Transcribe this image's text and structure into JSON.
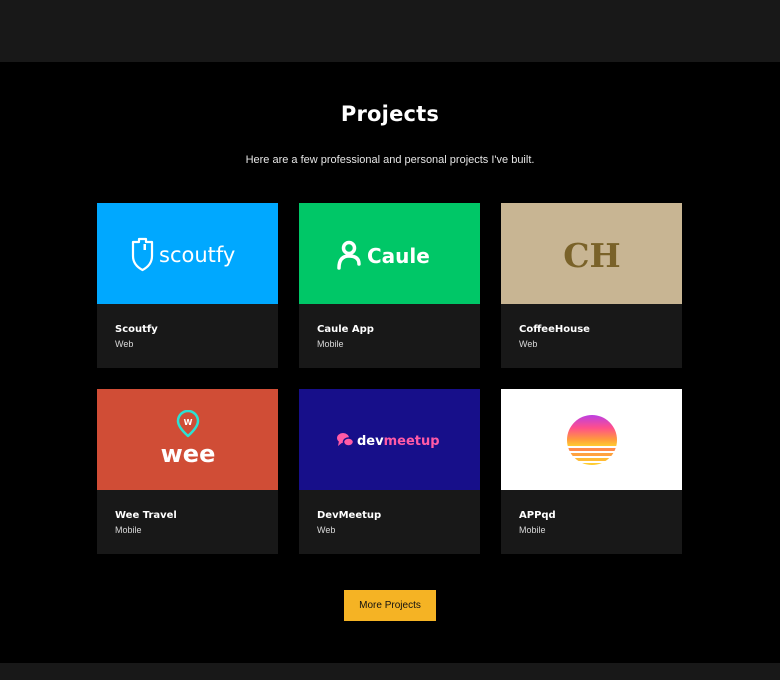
{
  "section": {
    "title": "Projects",
    "subtitle": "Here are a few professional and personal projects I've built."
  },
  "projects": [
    {
      "name": "Scoutfy",
      "type": "Web",
      "logo_text": "scoutfy",
      "color": "#00a8ff",
      "icon": "shield-icon"
    },
    {
      "name": "Caule App",
      "type": "Mobile",
      "logo_text": "Caule",
      "color": "#00c767",
      "icon": "person-icon"
    },
    {
      "name": "CoffeeHouse",
      "type": "Web",
      "logo_text": "CH",
      "color": "#c8b593",
      "icon": "ch-monogram"
    },
    {
      "name": "Wee Travel",
      "type": "Mobile",
      "logo_text": "wee",
      "color": "#d04d36",
      "icon": "map-pin-icon"
    },
    {
      "name": "DevMeetup",
      "type": "Web",
      "logo_text_a": "dev",
      "logo_text_b": "meetup",
      "color": "#170f8a",
      "icon": "chat-bubbles-icon"
    },
    {
      "name": "APPqd",
      "type": "Mobile",
      "color": "#ffffff",
      "icon": "sunset-icon"
    }
  ],
  "more_button": "More Projects",
  "colors": {
    "accent": "#f5b324",
    "card_bg": "#181818",
    "page_bg": "#000000"
  }
}
